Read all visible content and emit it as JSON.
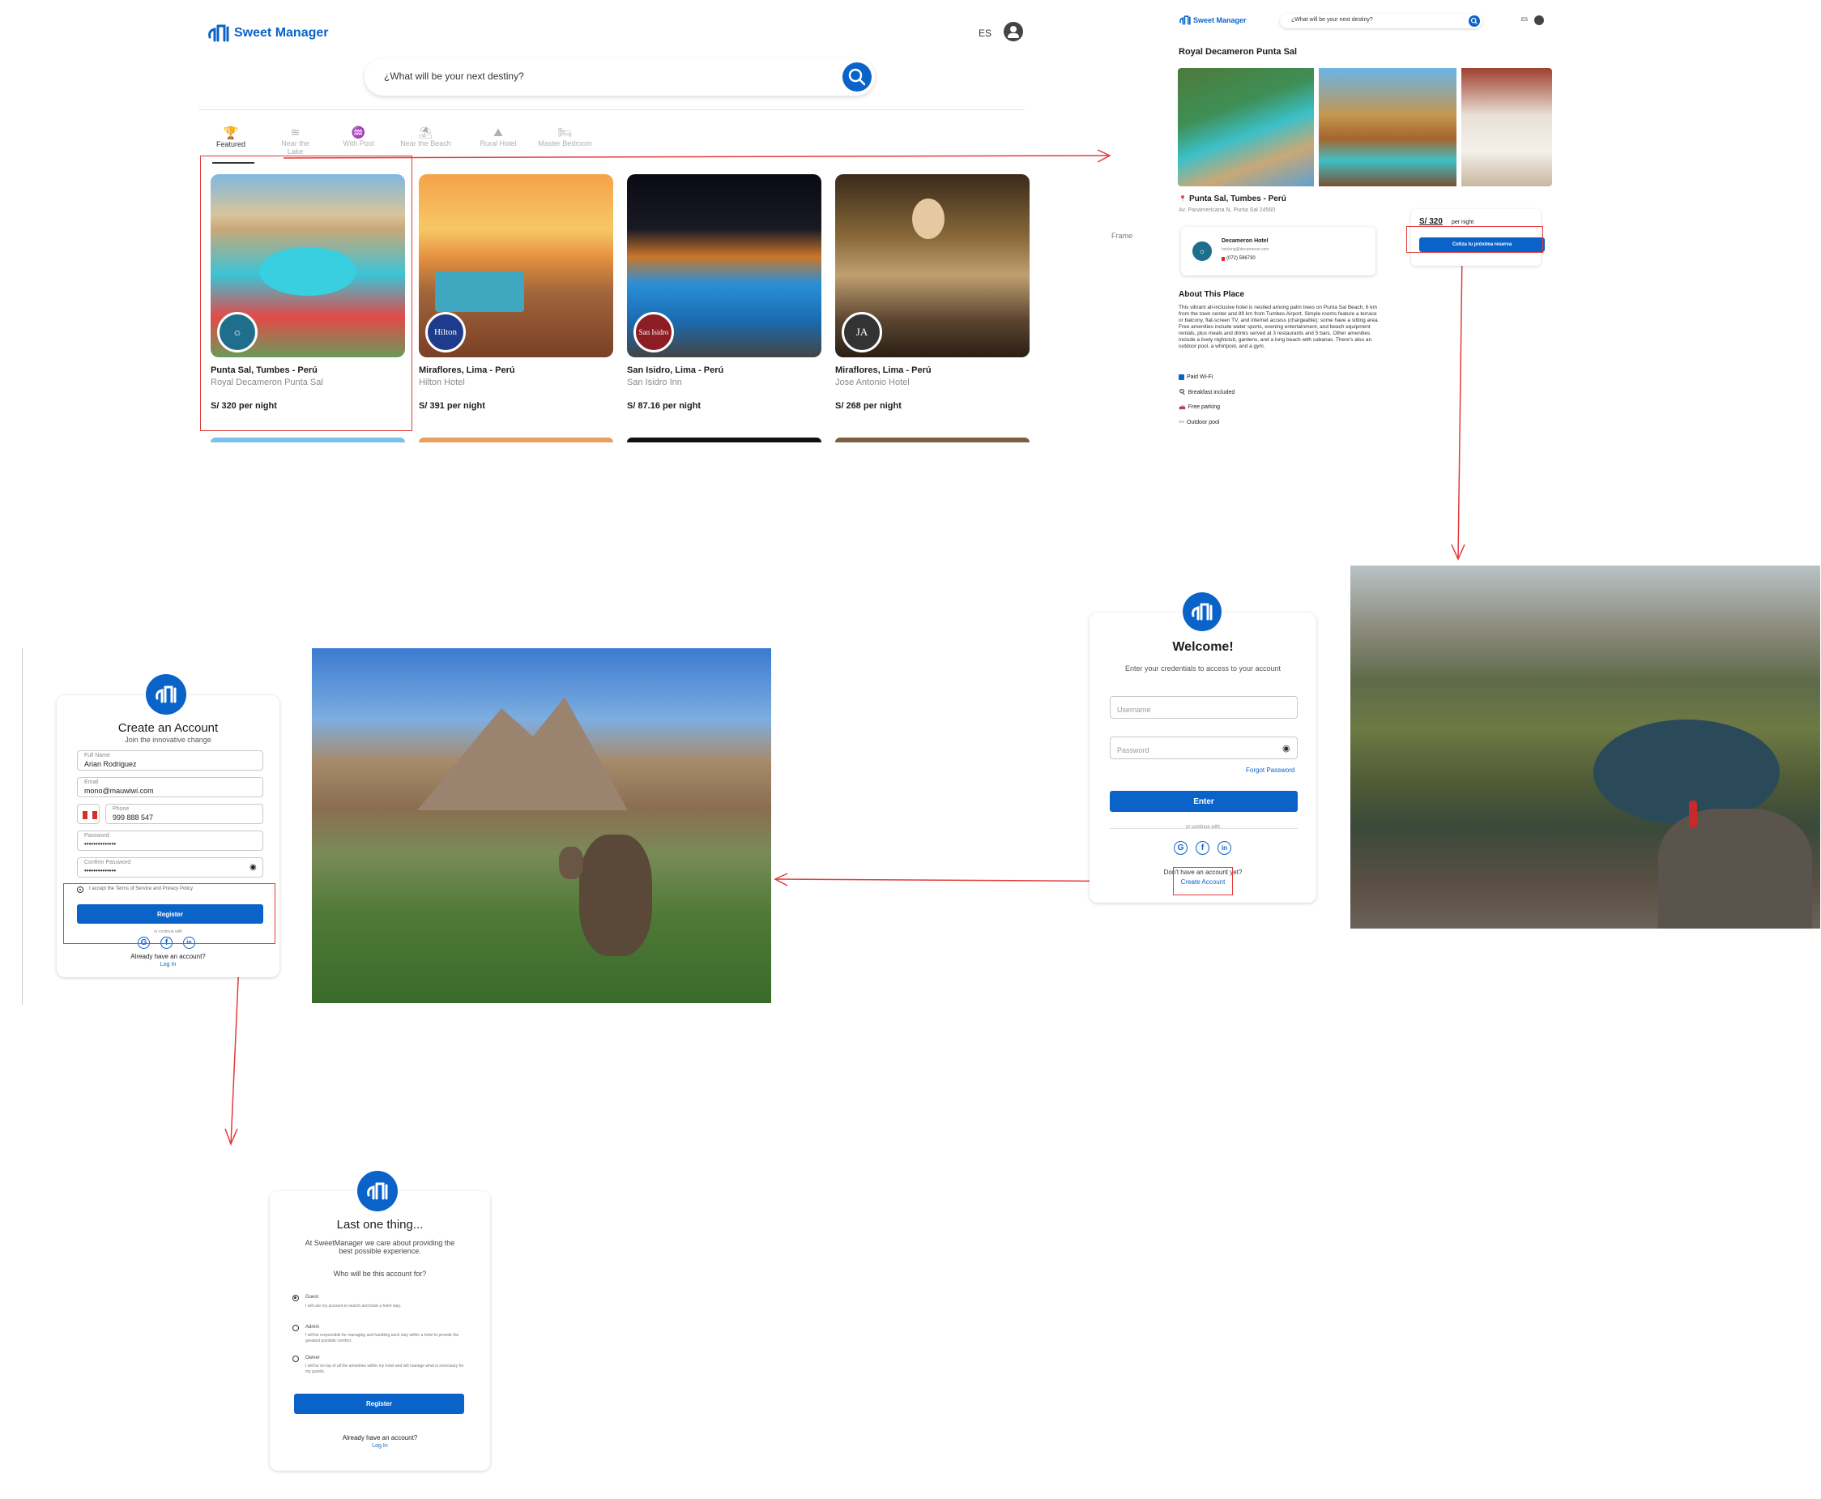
{
  "brand": {
    "name": "Sweet Manager",
    "color_primary": "#0a63c9",
    "color_flow_arrow": "#e23b3b"
  },
  "home": {
    "lang": "ES",
    "search_placeholder": "¿What will be your next destiny?",
    "categories": [
      "Featured",
      "Near the Lake",
      "With Pool",
      "Near the Beach",
      "Rural Hotel",
      "Master Bedroom"
    ],
    "hotels": [
      {
        "location": "Punta Sal, Tumbes - Perú",
        "name": "Royal Decameron Punta Sal",
        "price": "S/ 320 per night",
        "badge": "Decameron"
      },
      {
        "location": "Miraflores, Lima - Perú",
        "name": "Hilton Hotel",
        "price": "S/ 391 per night",
        "badge": "Hilton"
      },
      {
        "location": "San Isidro, Lima - Perú",
        "name": "San Isidro Inn",
        "price": "S/ 87.16 per night",
        "badge": "San Isidro"
      },
      {
        "location": "Miraflores, Lima - Perú",
        "name": "Jose Antonio Hotel",
        "price": "S/ 268 per night",
        "badge": "JA"
      }
    ]
  },
  "detail": {
    "search_placeholder": "¿What will be your next destiny?",
    "lang": "ES",
    "title": "Royal Decameron Punta Sal",
    "location": "Punta Sal, Tumbes - Perú",
    "address": "Av. Panamericana N, Punta Sal 24560",
    "price_value": "S/ 320",
    "price_unit": "per night",
    "reserve_button": "Cotiza tu próxima reserva",
    "frame_label": "Frame",
    "contact_name": "Decameron Hotel",
    "contact_email": "booking@decameron.com",
    "contact_phone": "(072) 596730",
    "about_title": "About This Place",
    "about_text": "This vibrant all-inclusive hotel is nestled among palm trees on Punta Sal Beach, 6 km from the town center and 89 km from Tumbes Airport. Simple rooms feature a terrace or balcony, flat-screen TV, and internet access (chargeable); some have a sitting area. Free amenities include water sports, evening entertainment, and beach equipment rentals, plus meals and drinks served at 3 restaurants and 5 bars. Other amenities include a lively nightclub, gardens, and a long beach with cabanas. There's also an outdoor pool, a whirlpool, and a gym.",
    "amenities": [
      "Paid Wi-Fi",
      "Breakfast included",
      "Free parking",
      "Outdoor pool"
    ]
  },
  "login": {
    "title": "Welcome!",
    "subtitle": "Enter your credentials to access to your account",
    "username_placeholder": "Username",
    "password_placeholder": "Password",
    "forgot": "Forgot Password",
    "enter_button": "Enter",
    "continue_with": "or continue with",
    "no_account": "Don't have an account yet?",
    "create_account": "Create Account"
  },
  "register": {
    "title": "Create an Account",
    "subtitle": "Join the innovative change",
    "fullname_label": "Full Name",
    "fullname_value": "Arian Rodriguez",
    "email_label": "Email",
    "email_value": "mono@mauwiwi.com",
    "phone_label": "Phone",
    "phone_value": "999 888 547",
    "password_label": "Password",
    "password_value": "••••••••••••••",
    "confirm_label": "Confirm Password",
    "confirm_value": "••••••••••••••",
    "terms": "I accept the Terms of Service and Privacy Policy",
    "register_button": "Register",
    "continue_with": "or continue with",
    "have_account": "Already have an account?",
    "login_link": "Log In"
  },
  "role": {
    "title": "Last one thing...",
    "subtitle": "At SweetManager we care about providing the best possible experience.",
    "question": "Who will be this account for?",
    "options": [
      {
        "label": "Guest",
        "desc": "I will use my account to search and book a hotel stay.",
        "selected": true
      },
      {
        "label": "Admin",
        "desc": "I will be responsible for managing and handling each stay within a hotel to provide the greatest possible comfort.",
        "selected": false
      },
      {
        "label": "Owner",
        "desc": "I will be on top of all the amenities within my hotel and will manage what is necessary for my guests.",
        "selected": false
      }
    ],
    "register_button": "Register",
    "have_account": "Already have an account?",
    "login_link": "Log In"
  }
}
